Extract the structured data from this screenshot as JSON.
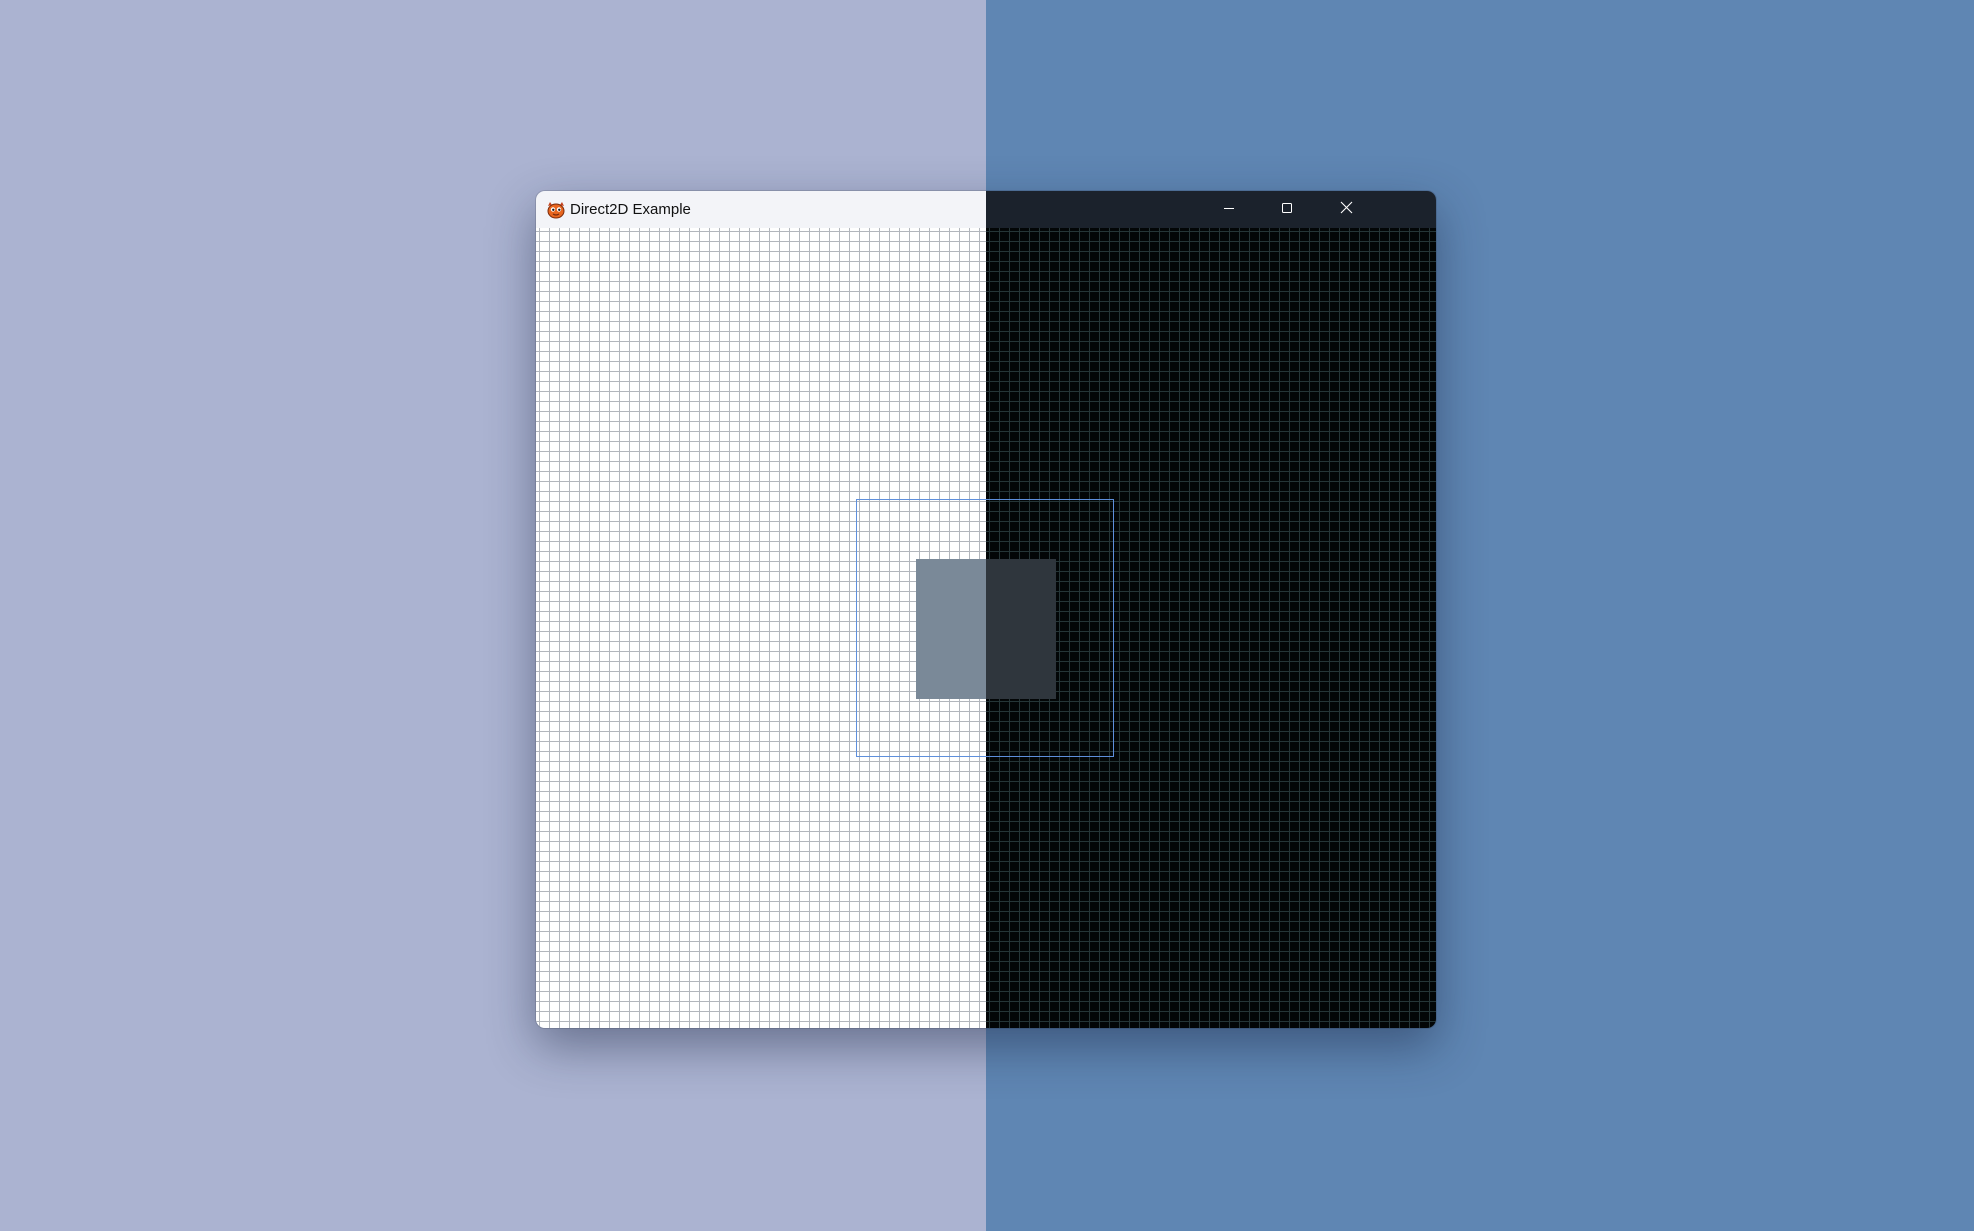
{
  "window": {
    "title": "Direct2D Example",
    "app_icon": "ferris-crab-icon",
    "caption_buttons": [
      "minimize-icon",
      "maximize-icon",
      "close-icon"
    ]
  },
  "theme": {
    "desktop_light": "#abb3d1",
    "desktop_dark": "#5f86b3",
    "titlebar_light": "#f3f4f8",
    "titlebar_dark": "#1b222c",
    "canvas_light": "#ffffff",
    "canvas_dark": "#030607",
    "grid_light": "#b2b6bc",
    "grid_dark": "#253537",
    "outline_rect": "#5e8fdc",
    "fill_rect_light": "#7a8998",
    "fill_rect_dark": "#2f363d"
  }
}
